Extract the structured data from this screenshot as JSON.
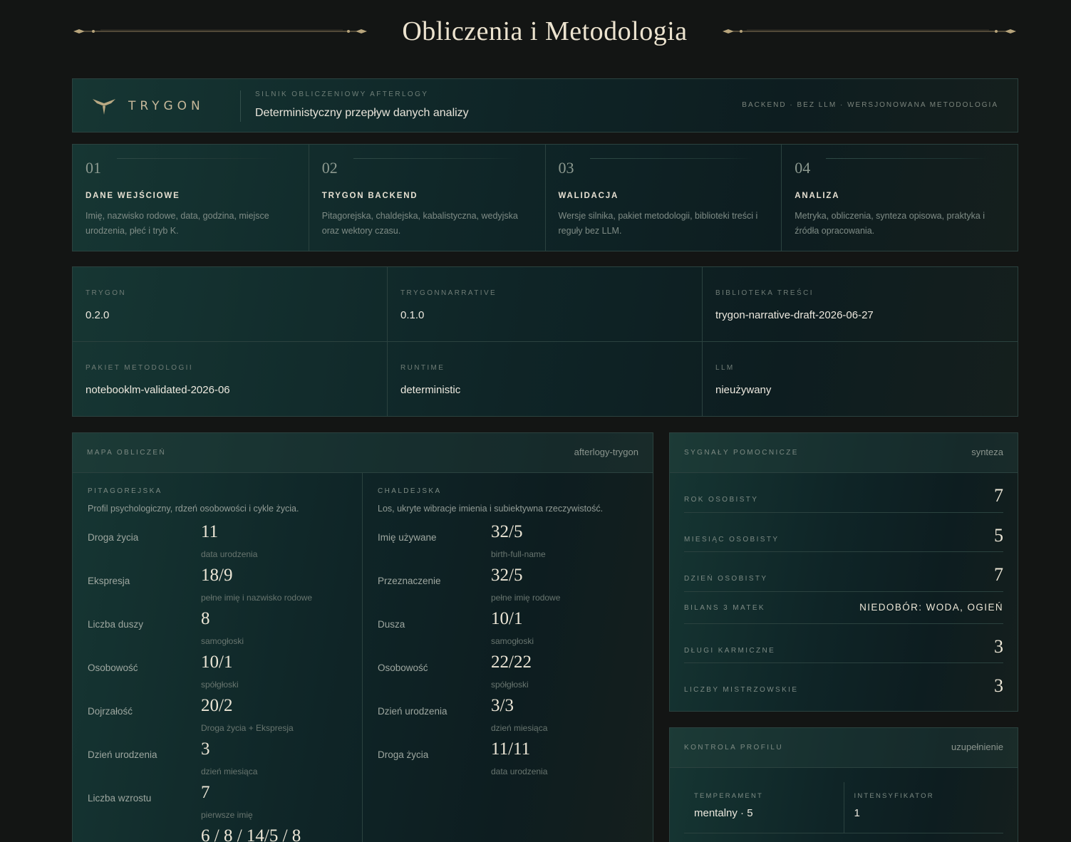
{
  "header": {
    "title": "Obliczenia i Metodologia"
  },
  "engine": {
    "brand": "TRYGON",
    "label": "SILNIK OBLICZENIOWY AFTERLOGY",
    "description": "Deterministyczny przepływ danych analizy",
    "tags": "BACKEND · BEZ LLM · WERSJONOWANA METODOLOGIA"
  },
  "pipeline": [
    {
      "num": "01",
      "title": "DANE WEJŚCIOWE",
      "text": "Imię, nazwisko rodowe, data, godzina, miejsce urodzenia, płeć i tryb K."
    },
    {
      "num": "02",
      "title": "TRYGON BACKEND",
      "text": "Pitagorejska, chaldejska, kabalistyczna, wedyjska oraz wektory czasu."
    },
    {
      "num": "03",
      "title": "WALIDACJA",
      "text": "Wersje silnika, pakiet metodologii, biblioteki treści i reguły bez LLM."
    },
    {
      "num": "04",
      "title": "ANALIZA",
      "text": "Metryka, obliczenia, synteza opisowa, praktyka i źródła opracowania."
    }
  ],
  "versions": [
    {
      "label": "TRYGON",
      "value": "0.2.0"
    },
    {
      "label": "TRYGONNARRATIVE",
      "value": "0.1.0"
    },
    {
      "label": "BIBLIOTEKA TREŚCI",
      "value": "trygon-narrative-draft-2026-06-27"
    },
    {
      "label": "PAKIET METODOLOGII",
      "value": "notebooklm-validated-2026-06"
    },
    {
      "label": "RUNTIME",
      "value": "deterministic"
    },
    {
      "label": "LLM",
      "value": "nieużywany"
    }
  ],
  "map": {
    "label": "MAPA OBLICZEŃ",
    "right": "afterlogy-trygon",
    "pythagorean": {
      "label": "PITAGOREJSKA",
      "desc": "Profil psychologiczny, rdzeń osobowości i cykle życia.",
      "rows": [
        {
          "name": "Droga życia",
          "value": "11",
          "sub": "data urodzenia"
        },
        {
          "name": "Ekspresja",
          "value": "18/9",
          "sub": "pełne imię i nazwisko rodowe"
        },
        {
          "name": "Liczba duszy",
          "value": "8",
          "sub": "samogłoski"
        },
        {
          "name": "Osobowość",
          "value": "10/1",
          "sub": "spółgłoski"
        },
        {
          "name": "Dojrzałość",
          "value": "20/2",
          "sub": "Droga życia + Ekspresja"
        },
        {
          "name": "Dzień urodzenia",
          "value": "3",
          "sub": "dzień miesiąca"
        },
        {
          "name": "Liczba wzrostu",
          "value": "7",
          "sub": "pierwsze imię"
        },
        {
          "name": "",
          "value": "6 / 8 / 14/5 / 8",
          "sub": ""
        }
      ]
    },
    "chaldean": {
      "label": "CHALDEJSKA",
      "desc": "Los, ukryte wibracje imienia i subiektywna rzeczywistość.",
      "rows": [
        {
          "name": "Imię używane",
          "value": "32/5",
          "sub": "birth-full-name"
        },
        {
          "name": "Przeznaczenie",
          "value": "32/5",
          "sub": "pełne imię rodowe"
        },
        {
          "name": "Dusza",
          "value": "10/1",
          "sub": "samogłoski"
        },
        {
          "name": "Osobowość",
          "value": "22/22",
          "sub": "spółgłoski"
        },
        {
          "name": "Dzień urodzenia",
          "value": "3/3",
          "sub": "dzień miesiąca"
        },
        {
          "name": "Droga życia",
          "value": "11/11",
          "sub": "data urodzenia"
        }
      ]
    }
  },
  "signals": {
    "label": "SYGNAŁY POMOCNICZE",
    "right": "synteza",
    "rows": [
      {
        "label": "ROK OSOBISTY",
        "value": "7"
      },
      {
        "label": "MIESIĄC OSOBISTY",
        "value": "5"
      },
      {
        "label": "DZIEŃ OSOBISTY",
        "value": "7"
      },
      {
        "label": "BILANS 3 MATEK",
        "value": "NIEDOBÓR: WODA, OGIEŃ"
      },
      {
        "label": "DŁUGI KARMICZNE",
        "value": "3"
      },
      {
        "label": "LICZBY MISTRZOWSKIE",
        "value": "3"
      }
    ]
  },
  "profile": {
    "label": "KONTROLA PROFILU",
    "right": "uzupełnienie",
    "cells": [
      {
        "label": "TEMPERAMENT",
        "value": "mentalny · 5"
      },
      {
        "label": "INTENSYFIKATOR",
        "value": "1"
      }
    ]
  }
}
